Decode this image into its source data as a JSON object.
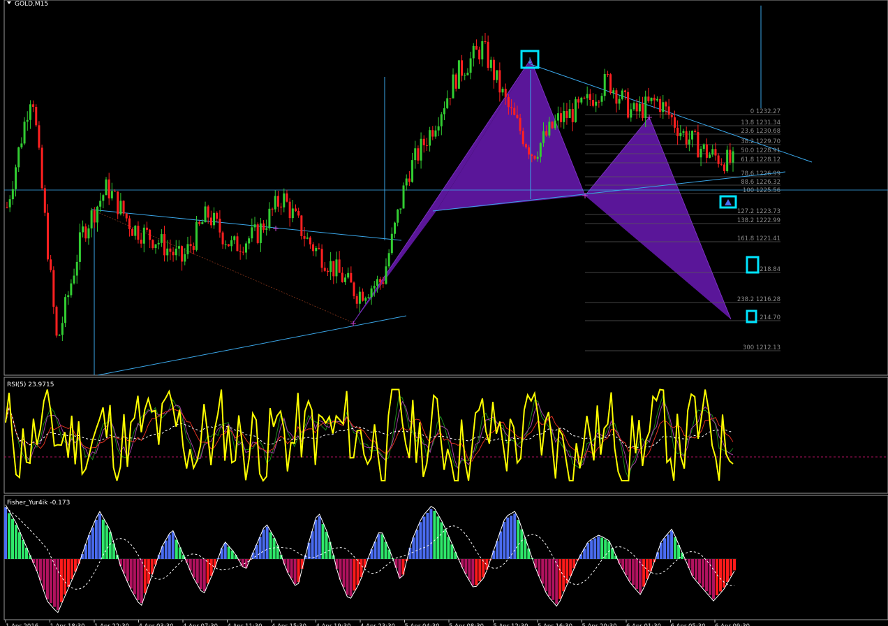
{
  "window": {
    "symbol_title": "GOLD,M15"
  },
  "colors": {
    "background": "#000000",
    "bull_candle": "#32cd32",
    "bear_candle": "#ff2020",
    "pattern_fill": "#5a1699",
    "trendline": "#3aa6e8",
    "marker": "#00e5ff",
    "fib_line": "#5a5a5a",
    "rsi_main": "#ffff00",
    "hist_pos_blue": "#4a6cf0",
    "hist_pos_green": "#2ee86a",
    "hist_neg_red": "#ff1a1a",
    "hist_neg_magenta": "#b0125e"
  },
  "fib_levels": [
    {
      "label": "0 1232.27"
    },
    {
      "label": "13.8 1231.34"
    },
    {
      "label": "23.6 1230.68"
    },
    {
      "label": "38.2 1229.70"
    },
    {
      "label": "50.0 1228.91"
    },
    {
      "label": "61.8 1228.12"
    },
    {
      "label": "78.6 1226.99"
    },
    {
      "label": "88.6 1226.32"
    },
    {
      "label": "100 1225.56"
    },
    {
      "label": "127.2 1223.73"
    },
    {
      "label": "138.2 1222.99"
    },
    {
      "label": "161.8 1221.41"
    },
    {
      "label": "218.84"
    },
    {
      "label": "238.2 1216.28"
    },
    {
      "label": "214.70"
    },
    {
      "label": "300 1212.13"
    }
  ],
  "rsi_panel": {
    "label": "RSI(5) 23.9715"
  },
  "fisher_panel": {
    "label": "Fisher_Yur4ik -0.173"
  },
  "chart_data": {
    "type": "line",
    "title": "GOLD,M15",
    "x_ticks": [
      "1 Apr 2016",
      "1 Apr 18:30",
      "1 Apr 22:30",
      "4 Apr 03:30",
      "4 Apr 07:30",
      "4 Apr 11:30",
      "4 Apr 15:30",
      "4 Apr 19:30",
      "4 Apr 23:30",
      "5 Apr 04:30",
      "5 Apr 08:30",
      "5 Apr 12:30",
      "5 Apr 16:30",
      "5 Apr 20:30",
      "6 Apr 01:30",
      "6 Apr 05:30",
      "6 Apr 09:30"
    ],
    "price_points": [
      1222.5,
      1231.5,
      1212.2,
      1220.5,
      1224.0,
      1221.0,
      1220.0,
      1218.5,
      1222.0,
      1219.5,
      1220.5,
      1223.3,
      1220.0,
      1218.0,
      1216.0,
      1217.0,
      1225.0,
      1228.5,
      1232.5,
      1234.5,
      1230.0,
      1226.5,
      1229.0,
      1230.0,
      1232.0,
      1229.5,
      1230.5,
      1228.0,
      1226.5,
      1225.8
    ],
    "xabcd_pattern": {
      "X": 1215.6,
      "A": 1234.8,
      "B": 1225.6,
      "C": 1232.3,
      "D": 1214.7
    },
    "rsi_level_marked": 30,
    "rsi_value": 23.9715,
    "fisher_value": -0.173,
    "fisher_histogram": [
      0.9,
      0.6,
      0.2,
      -0.2,
      -0.7,
      -0.9,
      -0.5,
      -0.1,
      0.4,
      0.8,
      0.5,
      -0.1,
      -0.5,
      -0.8,
      -0.3,
      0.2,
      0.5,
      0.1,
      -0.3,
      -0.6,
      -0.2,
      0.3,
      0.1,
      -0.2,
      0.2,
      0.6,
      0.3,
      -0.2,
      -0.5,
      0.2,
      0.8,
      0.4,
      -0.3,
      -0.7,
      -0.4,
      0.1,
      0.5,
      0.1,
      -0.4,
      0.3,
      0.7,
      0.9,
      0.6,
      0.2,
      -0.2,
      -0.5,
      -0.3,
      0.2,
      0.7,
      0.8,
      0.3,
      -0.2,
      -0.6,
      -0.8,
      -0.4,
      0.0,
      0.3,
      0.4,
      0.3,
      -0.1,
      -0.4,
      -0.6,
      -0.2,
      0.3,
      0.5,
      0.1,
      -0.3,
      -0.5,
      -0.7,
      -0.5,
      -0.2
    ]
  }
}
